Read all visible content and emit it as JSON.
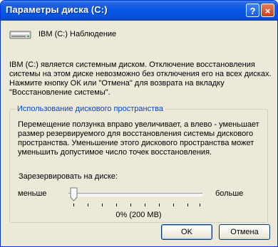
{
  "window": {
    "title": "Параметры диска (C:)",
    "help_button": "?",
    "close_button": "×"
  },
  "drive": {
    "label": "IBM (C:)  Наблюдение"
  },
  "info_text": "IBM (C:) является системным диском. Отключение восстановления системы на этом диске невозможно без отключения его на всех дисках. Нажмите кнопку ОК или \"Отмена\" для возврата на вкладку \"Восстановление системы\".",
  "usage_group": {
    "title": "Использование дискового пространства",
    "text": "Перемещение ползунка вправо увеличивает, а влево - уменьшает размер резервируемого для восстановления системы дискового пространства. Уменьшение этого дискового пространства может уменьшить допустимое число точек восстановления.",
    "reserve_label": "Зарезервировать на диске:",
    "less": "меньше",
    "more": "больше",
    "value": "0% (200 MB)",
    "slider_fraction": 0
  },
  "buttons": {
    "ok": "OK",
    "cancel": "Отмена"
  },
  "colors": {
    "titlebar": "#0a59e8",
    "dialog_bg": "#ece9d8",
    "group_title": "#0046d5"
  }
}
